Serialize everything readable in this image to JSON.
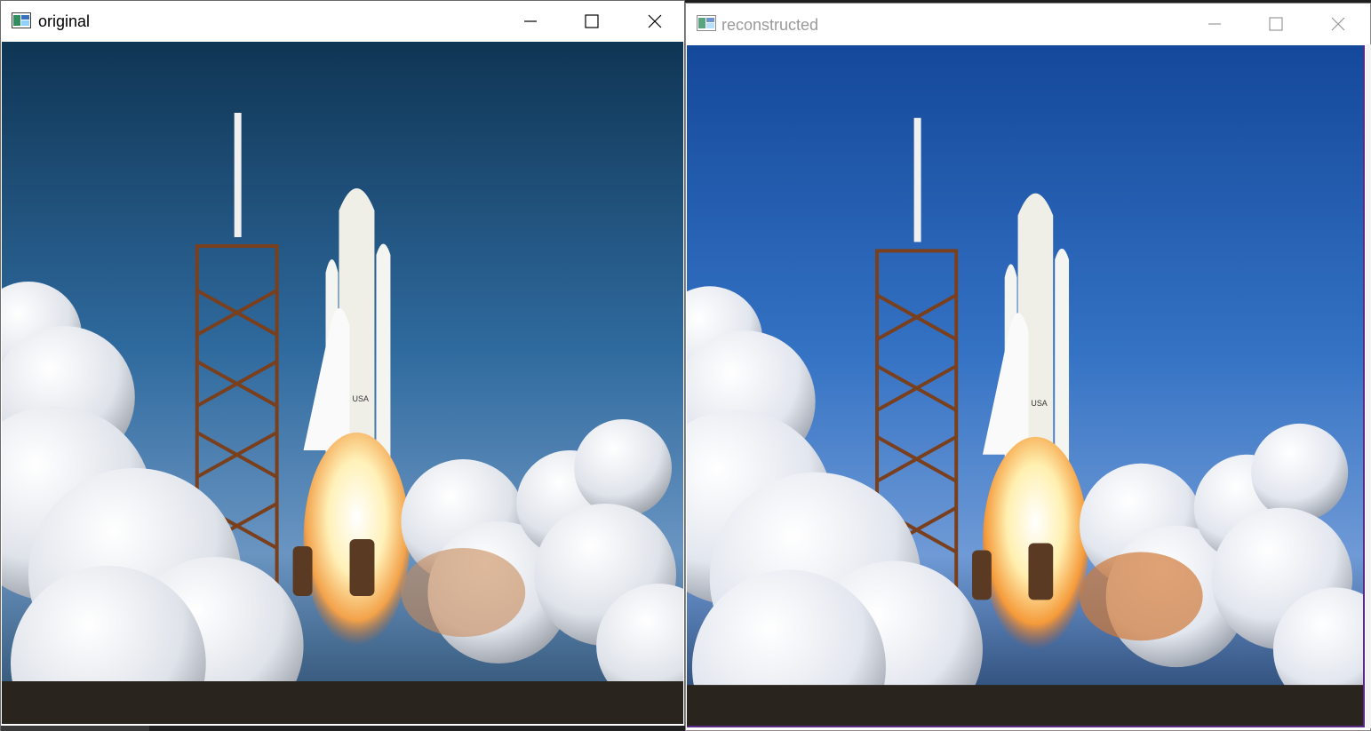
{
  "windows": [
    {
      "id": "original",
      "title": "original",
      "controls": {
        "minimize": "minimize-icon",
        "maximize": "maximize-icon",
        "close": "close-icon"
      },
      "focused": true
    },
    {
      "id": "reconstructed",
      "title": "reconstructed",
      "controls": {
        "minimize": "minimize-icon",
        "maximize": "maximize-icon",
        "close": "close-icon"
      },
      "focused": false
    }
  ],
  "image": {
    "subject": "space-shuttle-launch",
    "tail_marking": "USA"
  },
  "colors": {
    "sky_top": "#123a5c",
    "sky_bottom": "#5b86b6",
    "reconstructed_sky_top": "#1b4f9a",
    "reconstructed_border": "#5a2a8a",
    "smoke": "#e9ecf0",
    "flame": "#fff4c8",
    "tower": "#8a4a22",
    "ground": "#2a241e"
  }
}
